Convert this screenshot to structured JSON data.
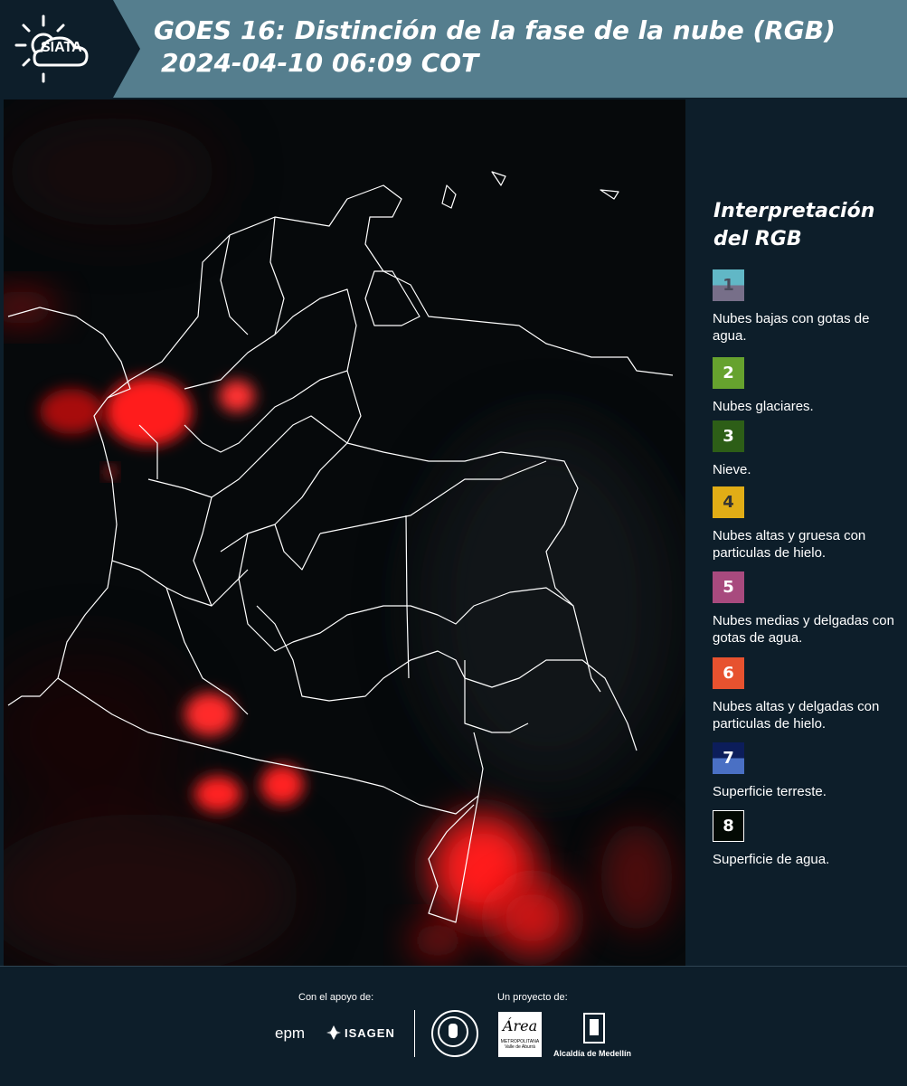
{
  "header": {
    "logo_text": "SIATA",
    "title_line1": "GOES 16: Distinción de la fase de la nube (RGB)",
    "title_line2": "2024-04-10 06:09 COT"
  },
  "legend": {
    "title_line1": "Interpretación",
    "title_line2": "del RGB",
    "items": [
      {
        "num": "1",
        "label": "Nubes bajas con gotas de agua.",
        "color_top": "#61b7c6",
        "color_bottom": "#776f89"
      },
      {
        "num": "2",
        "label": "Nubes glaciares.",
        "color_top": "#66a22e",
        "color_bottom": "#66a22e"
      },
      {
        "num": "3",
        "label": "Nieve.",
        "color_top": "#2d5e17",
        "color_bottom": "#2d5e17"
      },
      {
        "num": "4",
        "label": "Nubes altas y gruesa con particulas de hielo.",
        "color_top": "#e1ad16",
        "color_bottom": "#e1ad16"
      },
      {
        "num": "5",
        "label": "Nubes medias y delgadas con gotas de agua.",
        "color_top": "#a84a7e",
        "color_bottom": "#a84a7e"
      },
      {
        "num": "6",
        "label": "Nubes altas y delgadas con particulas de hielo.",
        "color_top": "#e7522f",
        "color_bottom": "#e7522f"
      },
      {
        "num": "7",
        "label": "Superficie terreste.",
        "color_top": "#0c1d5a",
        "color_bottom": "#4a70c4"
      },
      {
        "num": "8",
        "label": "Superficie de agua.",
        "color_top": "#030a04",
        "color_bottom": "#030a04"
      }
    ]
  },
  "footer": {
    "support_label": "Con el apoyo de:",
    "project_label": "Un proyecto de:",
    "epm_text": "epm",
    "isagen_text": "ISAGEN",
    "area_text": "Área",
    "area_sub": "METROPOLITANA",
    "area_sub2": "Valle de Aburrá",
    "alcaldia_text": "Alcaldía de Medellín"
  }
}
